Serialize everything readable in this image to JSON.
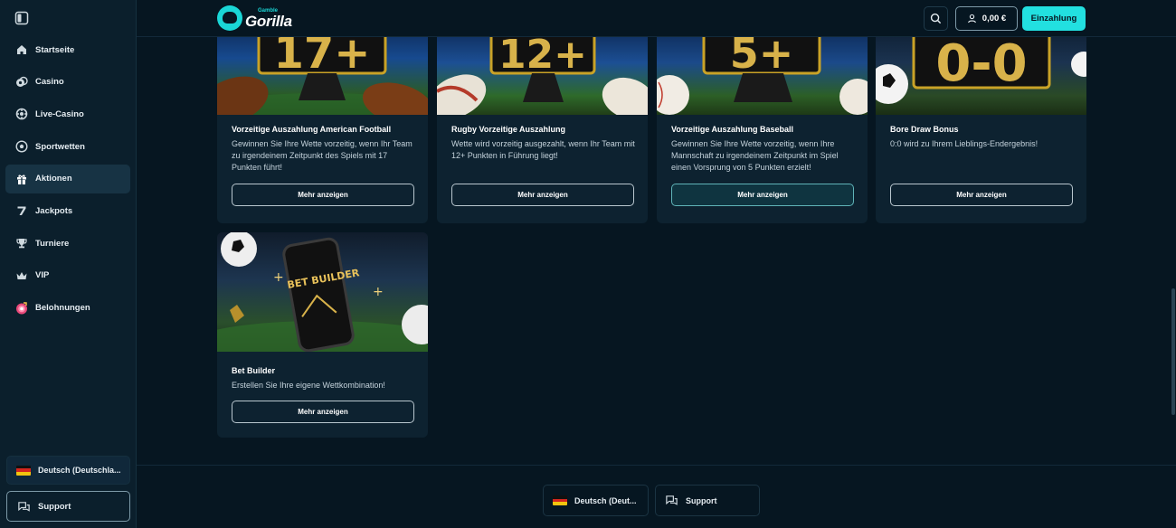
{
  "brand": {
    "small": "Gamble",
    "big": "Gorilla",
    "accent": "#1ad6d6"
  },
  "sidebar": {
    "items": [
      {
        "label": "Startseite",
        "icon": "home-icon"
      },
      {
        "label": "Casino",
        "icon": "casino-chip-icon"
      },
      {
        "label": "Live-Casino",
        "icon": "live-casino-icon"
      },
      {
        "label": "Sportwetten",
        "icon": "soccer-ball-icon"
      },
      {
        "label": "Aktionen",
        "icon": "gift-icon",
        "active": true
      },
      {
        "label": "Jackpots",
        "icon": "seven-icon"
      },
      {
        "label": "Turniere",
        "icon": "trophy-icon"
      },
      {
        "label": "VIP",
        "icon": "crown-icon"
      },
      {
        "label": "Belohnungen",
        "icon": "rewards-icon"
      }
    ],
    "language": "Deutsch (Deutschla...",
    "support": "Support"
  },
  "header": {
    "balance": "0,00 €",
    "deposit": "Einzahlung"
  },
  "promotions": [
    {
      "title": "Vorzeitige Auszahlung American Football",
      "desc": "Gewinnen Sie Ihre Wette vorzeitig, wenn Ihr Team zu irgendeinem Zeitpunkt des Spiels mit 17 Punkten führt!",
      "button": "Mehr anzeigen",
      "badge": "17+"
    },
    {
      "title": "Rugby Vorzeitige Auszahlung",
      "desc": "Wette wird vorzeitig ausgezahlt, wenn Ihr Team mit 12+ Punkten in Führung liegt!",
      "button": "Mehr anzeigen",
      "badge": "12+"
    },
    {
      "title": "Vorzeitige Auszahlung Baseball",
      "desc": "Gewinnen Sie Ihre Wette vorzeitig, wenn Ihre Mannschaft zu irgendeinem Zeitpunkt im Spiel einen Vorsprung von 5 Punkten erzielt!",
      "button": "Mehr anzeigen",
      "badge": "5+"
    },
    {
      "title": "Bore Draw Bonus",
      "desc": "0:0 wird zu Ihrem Lieblings-Endergebnis!",
      "button": "Mehr anzeigen",
      "badge": "0-0"
    },
    {
      "title": "Bet Builder",
      "desc": "Erstellen Sie Ihre eigene Wettkombination!",
      "button": "Mehr anzeigen",
      "badge": "BET BUILDER"
    }
  ],
  "footer": {
    "language": "Deutsch (Deut...",
    "support": "Support"
  }
}
